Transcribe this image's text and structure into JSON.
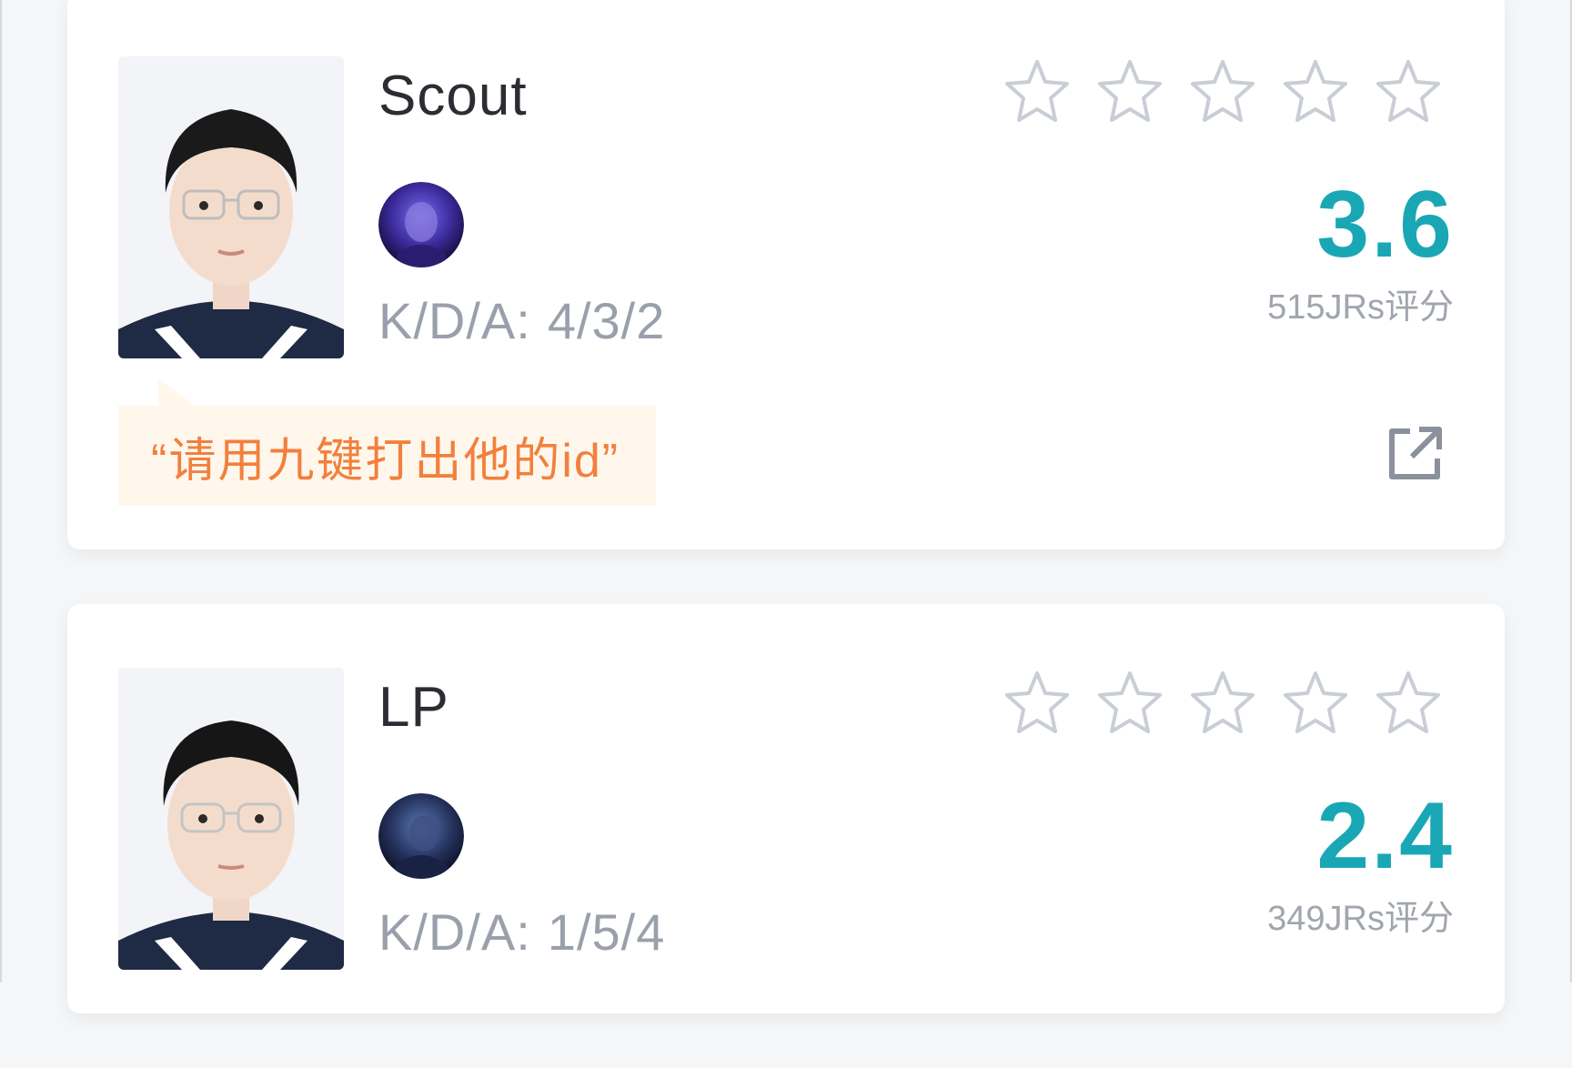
{
  "players": [
    {
      "name": "Scout",
      "kda_label": "K/D/A:",
      "kda_value": "4/3/2",
      "score": "3.6",
      "rating_label": "515JRs评分",
      "stars_filled": 0,
      "stars_total": 5,
      "comment": "“请用九键打出他的id”",
      "hero_icon": "hero-avatar-icon"
    },
    {
      "name": "LP",
      "kda_label": "K/D/A:",
      "kda_value": "1/5/4",
      "score": "2.4",
      "rating_label": "349JRs评分",
      "stars_filled": 0,
      "stars_total": 5,
      "hero_icon": "hero-avatar-icon"
    }
  ],
  "colors": {
    "score": "#1aa7b5",
    "comment_text": "#f2803d",
    "comment_bg": "#fff7ec",
    "star_outline": "#c9cdd6"
  }
}
